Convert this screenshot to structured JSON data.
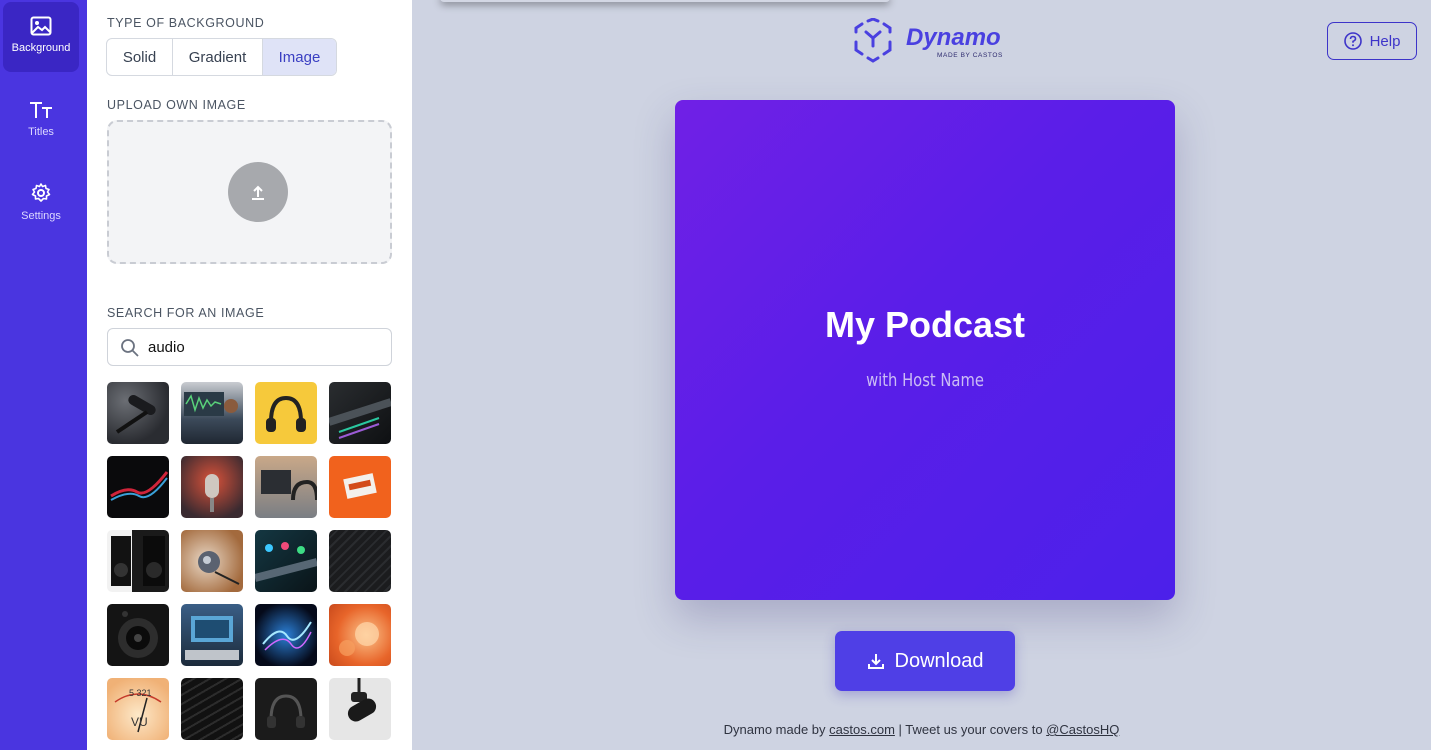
{
  "rail": {
    "items": [
      {
        "label": "Background",
        "icon": "image-icon"
      },
      {
        "label": "Titles",
        "icon": "text-size-icon"
      },
      {
        "label": "Settings",
        "icon": "gear-icon"
      }
    ]
  },
  "panel": {
    "bg_type_label": "TYPE OF BACKGROUND",
    "bg_types": [
      "Solid",
      "Gradient",
      "Image"
    ],
    "bg_type_selected": "Image",
    "upload_label": "UPLOAD OWN IMAGE",
    "search_label": "SEARCH FOR AN IMAGE",
    "search_value": "audio",
    "vu_scale": "5 321",
    "vu_label": "VU"
  },
  "header": {
    "logo_name": "Dynamo",
    "logo_sub": "MADE BY CASTOS",
    "help_label": "Help"
  },
  "cover": {
    "title": "My Podcast",
    "subtitle": "with Host Name"
  },
  "download_label": "Download",
  "footer": {
    "prefix": "Dynamo made by ",
    "link1": "castos.com",
    "middle": " | Tweet us your covers to ",
    "link2": "@CastosHQ"
  },
  "colors": {
    "rail": "#4a35e0",
    "accent": "#4f3fe6",
    "cover_gradient_start": "#7020e6",
    "cover_gradient_end": "#4c20ea",
    "main_bg": "#ced3e2"
  }
}
